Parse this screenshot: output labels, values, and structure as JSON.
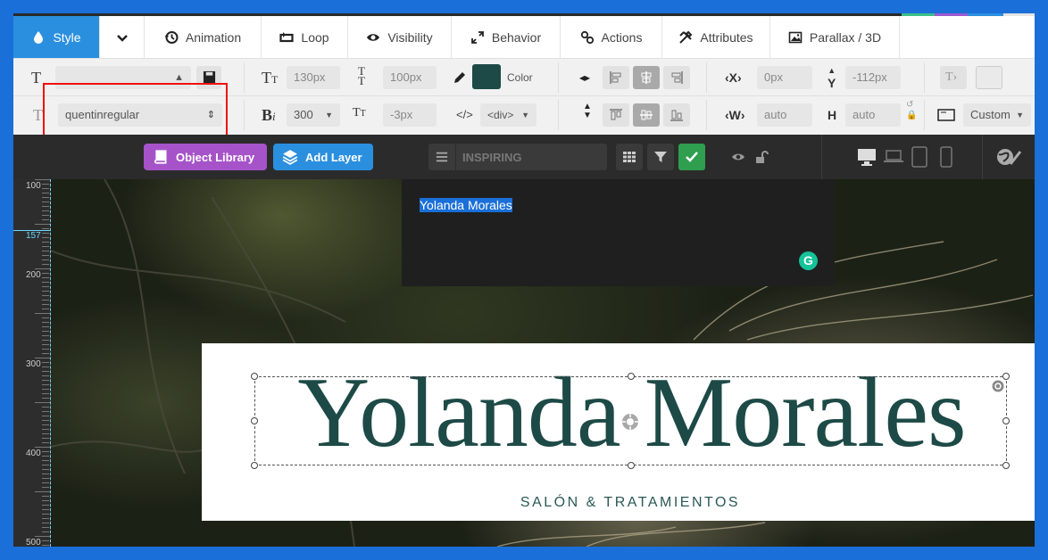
{
  "tabs": [
    {
      "label": "Style",
      "icon": "drop-icon"
    },
    {
      "label": "",
      "icon": "chevron-down-icon"
    },
    {
      "label": "Animation",
      "icon": "history-icon"
    },
    {
      "label": "Loop",
      "icon": "loop-icon"
    },
    {
      "label": "Visibility",
      "icon": "eye-icon"
    },
    {
      "label": "Behavior",
      "icon": "resize-icon"
    },
    {
      "label": "Actions",
      "icon": "link-icon"
    },
    {
      "label": "Attributes",
      "icon": "tools-icon"
    },
    {
      "label": "Parallax / 3D",
      "icon": "image-icon"
    }
  ],
  "toolbar": {
    "font_family": "quentinregular",
    "font_size": "130px",
    "line_height": "100px",
    "color_label": "Color",
    "color_value": "#1d4a46",
    "font_weight": "300",
    "letter_spacing": "-3px",
    "tag": "<div>",
    "x_label": "X",
    "x_value": "0px",
    "y_label": "Y",
    "y_value": "-112px",
    "w_label": "W",
    "w_value": "auto",
    "h_label": "H",
    "h_value": "auto",
    "size_mode": "Custom"
  },
  "actionbar": {
    "object_library": "Object Library",
    "add_layer": "Add Layer",
    "slide_name": "INSPIRING",
    "object_library_color": "#a653c9",
    "add_layer_color": "#2b8fdf",
    "check_color": "#2f9e4f"
  },
  "ruler": {
    "labels": [
      "100",
      "157",
      "200",
      "300",
      "400",
      "500"
    ],
    "highlight": "157"
  },
  "editor": {
    "text": "Yolanda Morales"
  },
  "canvas": {
    "title": "Yolanda Morales",
    "subtitle": "SALÓN & TRATAMIENTOS",
    "title_color": "#1d4a46"
  }
}
